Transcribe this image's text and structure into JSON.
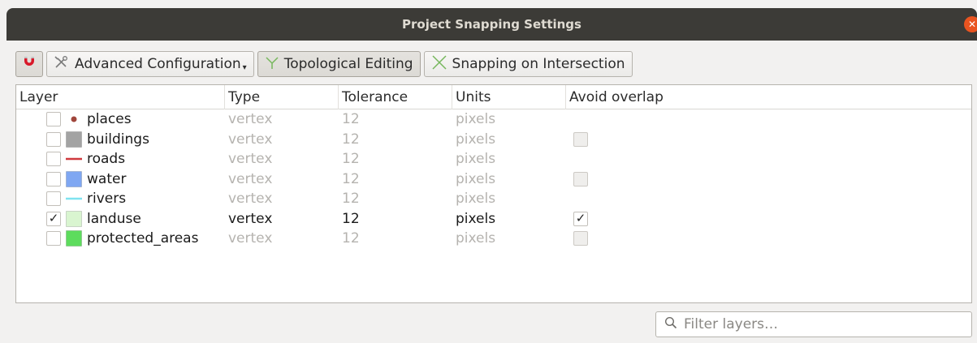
{
  "window": {
    "title": "Project Snapping Settings"
  },
  "toolbar": {
    "advanced_label": "Advanced Configuration",
    "topological_label": "Topological Editing",
    "intersection_label": "Snapping on Intersection"
  },
  "table": {
    "columns": [
      "Layer",
      "Type",
      "Tolerance",
      "Units",
      "Avoid overlap"
    ],
    "rows": [
      {
        "name": "places",
        "symbol": "point",
        "color": "#a0463c",
        "checked": false,
        "type": "vertex",
        "tolerance": "12",
        "units": "pixels",
        "avoid": null
      },
      {
        "name": "buildings",
        "symbol": "polygon",
        "color": "#a3a3a3",
        "checked": false,
        "type": "vertex",
        "tolerance": "12",
        "units": "pixels",
        "avoid": false
      },
      {
        "name": "roads",
        "symbol": "line",
        "color": "#d0393e",
        "checked": false,
        "type": "vertex",
        "tolerance": "12",
        "units": "pixels",
        "avoid": null
      },
      {
        "name": "water",
        "symbol": "polygon",
        "color": "#7fa7f2",
        "checked": false,
        "type": "vertex",
        "tolerance": "12",
        "units": "pixels",
        "avoid": false
      },
      {
        "name": "rivers",
        "symbol": "line",
        "color": "#7fe3f0",
        "checked": false,
        "type": "vertex",
        "tolerance": "12",
        "units": "pixels",
        "avoid": null
      },
      {
        "name": "landuse",
        "symbol": "polygon",
        "color": "#d9f5d0",
        "checked": true,
        "type": "vertex",
        "tolerance": "12",
        "units": "pixels",
        "avoid": true
      },
      {
        "name": "protected_areas",
        "symbol": "polygon",
        "color": "#5ddc5d",
        "checked": false,
        "type": "vertex",
        "tolerance": "12",
        "units": "pixels",
        "avoid": false
      }
    ]
  },
  "filter": {
    "placeholder": "Filter layers…"
  },
  "icons": {
    "magnet": "magnet-icon",
    "advanced": "advanced-config-icon",
    "topological": "topological-icon",
    "intersection": "intersection-icon",
    "search": "search-icon",
    "close": "close-icon"
  }
}
